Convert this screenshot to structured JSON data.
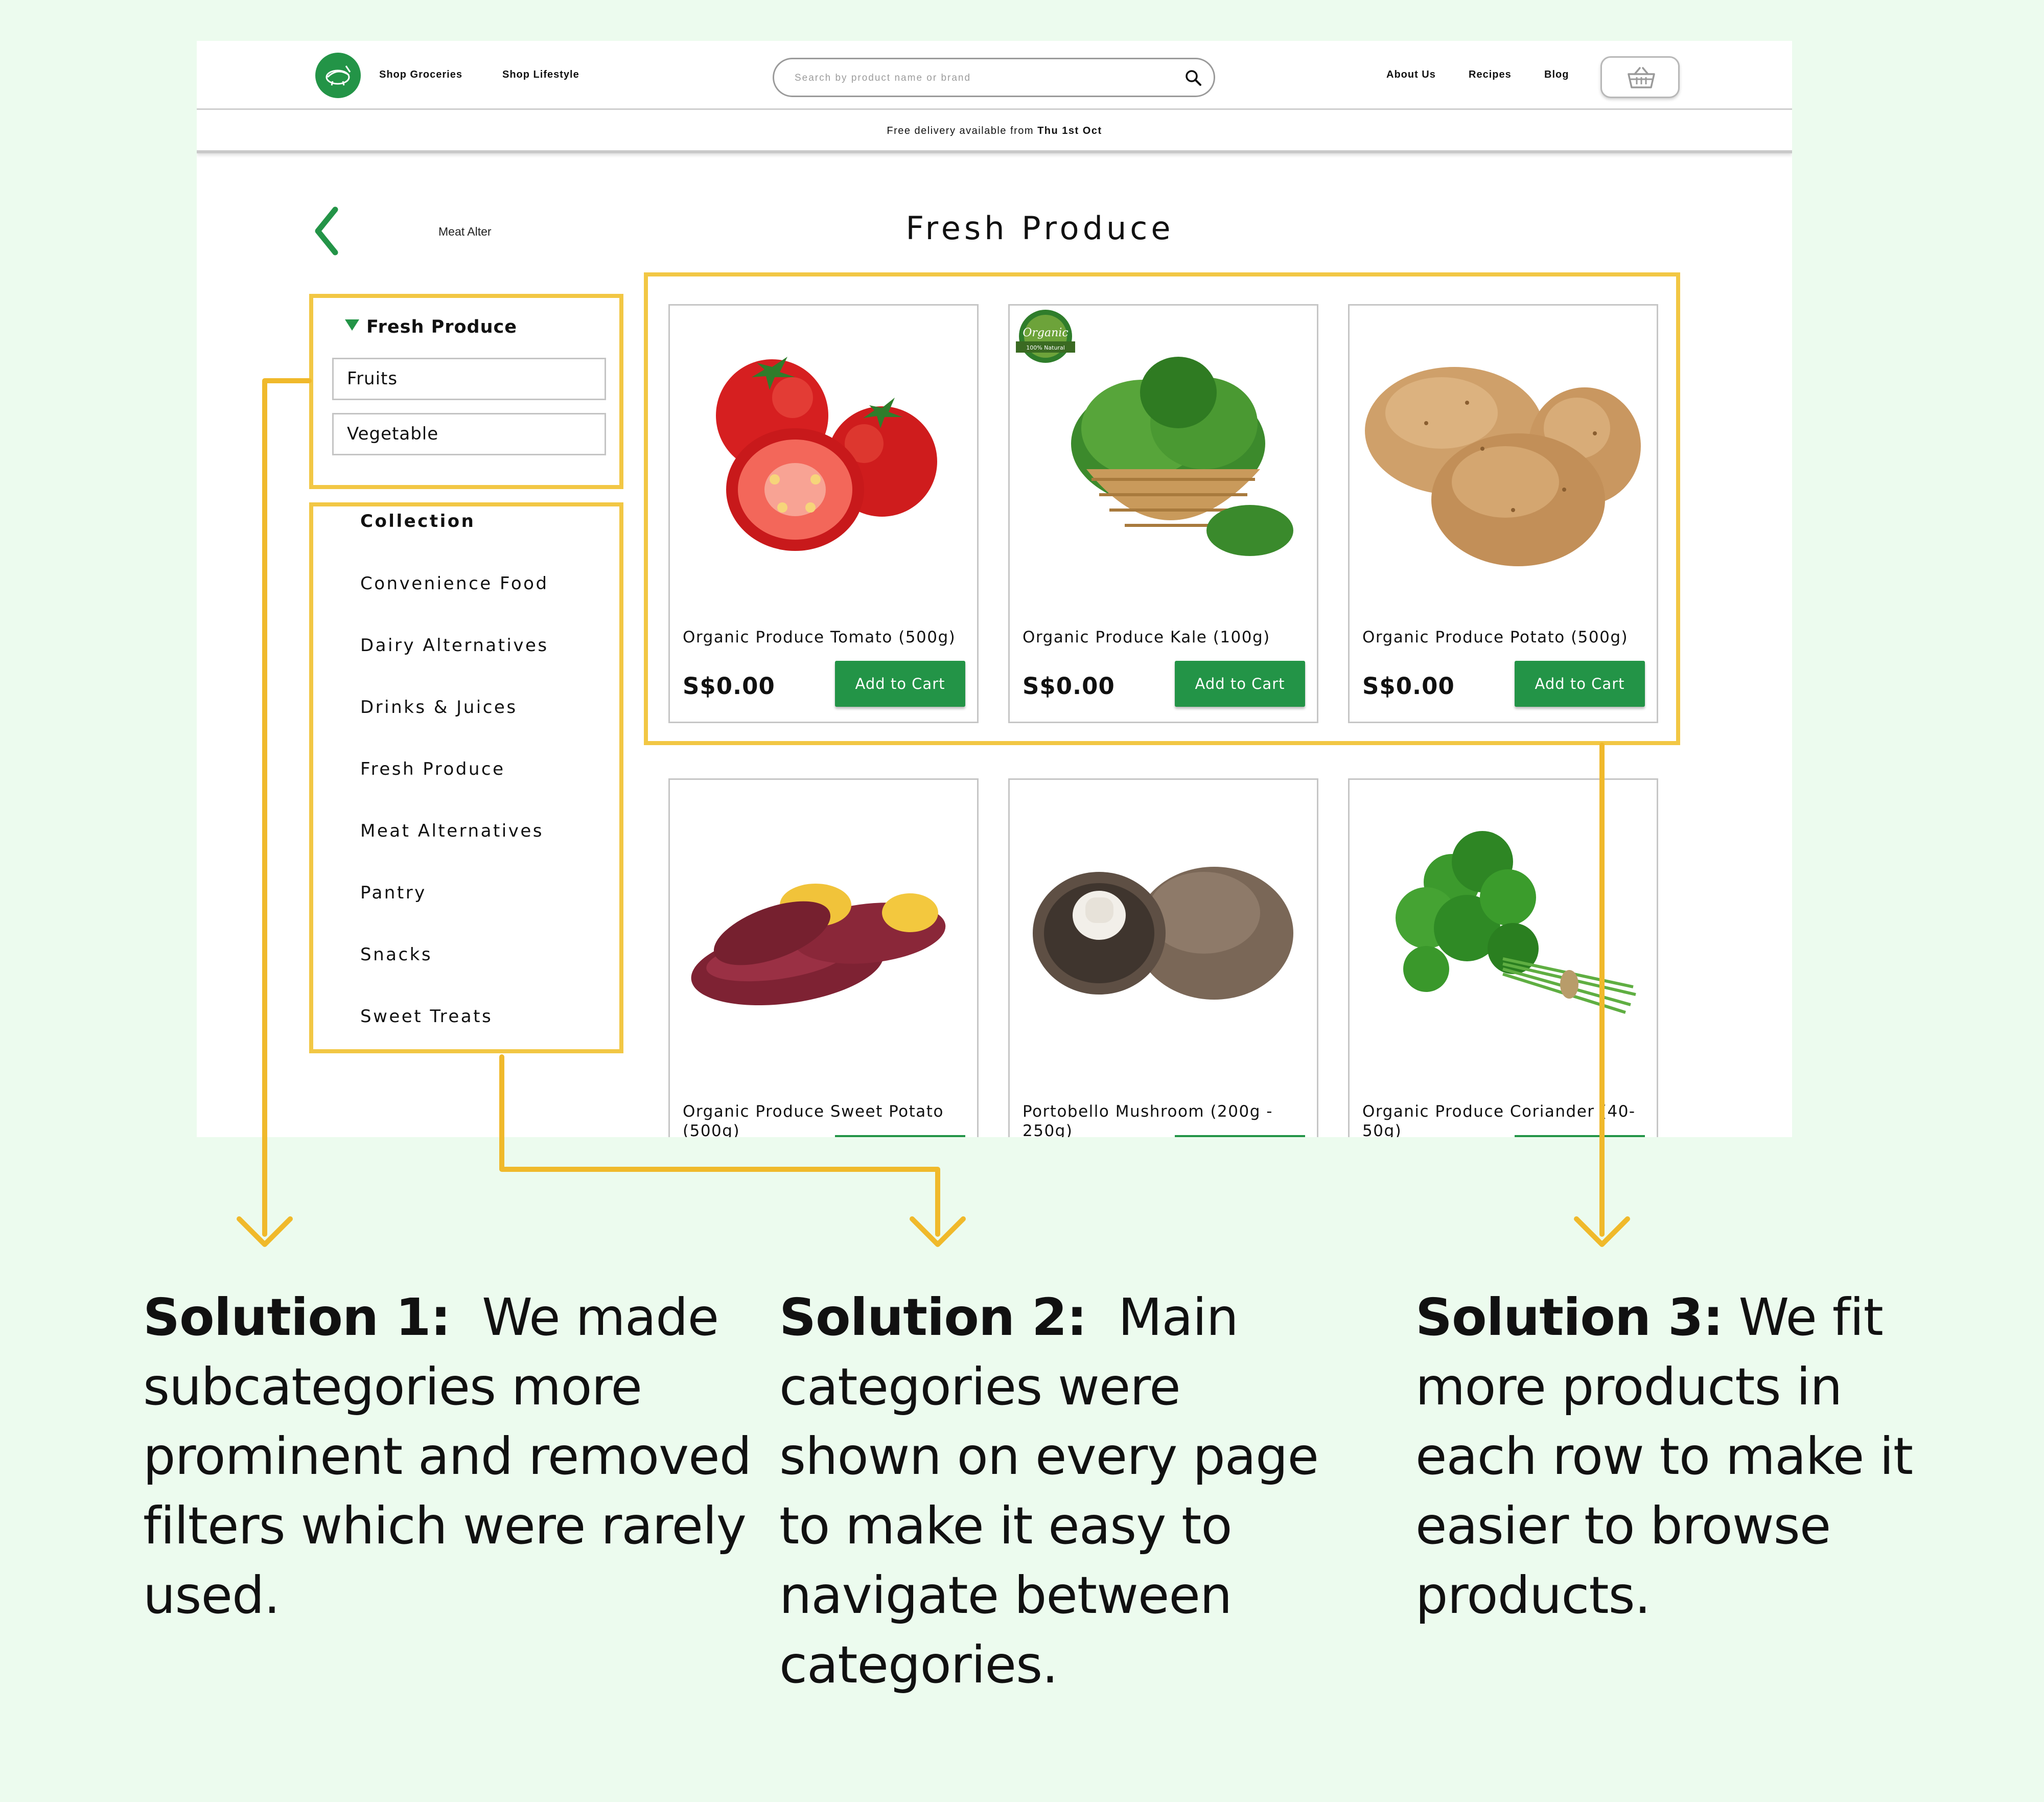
{
  "nav": {
    "shop_groceries": "Shop Groceries",
    "shop_lifestyle": "Shop Lifestyle",
    "search_placeholder": "Search by product name or brand",
    "about": "About Us",
    "recipes": "Recipes",
    "blog": "Blog"
  },
  "promo": {
    "prefix": "Free delivery available from",
    "date": "Thu 1st Oct"
  },
  "breadcrumb": "Meat Alter",
  "page_title": "Fresh Produce",
  "subcategories": {
    "title": "Fresh Produce",
    "items": [
      "Fruits",
      "Vegetable"
    ]
  },
  "collection": {
    "title": "Collection",
    "items": [
      "Convenience Food",
      "Dairy Alternatives",
      "Drinks & Juices",
      "Fresh Produce",
      "Meat Alternatives",
      "Pantry",
      "Snacks",
      "Sweet Treats"
    ]
  },
  "products": [
    {
      "name": "Organic Produce Tomato (500g)",
      "price": "S$0.00",
      "button": "Add to Cart",
      "image": "tomato"
    },
    {
      "name": "Organic Produce Kale (100g)",
      "price": "S$0.00",
      "button": "Add to Cart",
      "image": "kale",
      "badge": [
        "Organic",
        "100% Natural"
      ]
    },
    {
      "name": "Organic Produce Potato (500g)",
      "price": "S$0.00",
      "button": "Add to Cart",
      "image": "potato"
    },
    {
      "name": "Organic Produce Sweet Potato (500g)",
      "image": "sweet-potato"
    },
    {
      "name": "Portobello Mushroom (200g - 250g)",
      "image": "mushroom"
    },
    {
      "name": "Organic Produce Coriander (40-50g)",
      "image": "coriander"
    }
  ],
  "solutions": [
    {
      "heading": "Solution 1:",
      "text": "We made subcategories more prominent and removed filters which were rarely used."
    },
    {
      "heading": "Solution 2:",
      "text": "Main categories were shown on every page to make it easy to navigate between categories."
    },
    {
      "heading": "Solution 3:",
      "text": "We fit more products in each row to make it easier to browse products."
    }
  ],
  "colors": {
    "background": "#ecfbee",
    "brand_green": "#239447",
    "highlight_yellow": "#f2c744",
    "connector_yellow": "#f0b92b"
  },
  "icons": [
    "logo-icon",
    "search-icon",
    "basket-icon",
    "back-chevron-icon",
    "dropdown-triangle-icon",
    "arrow-down-icon"
  ]
}
